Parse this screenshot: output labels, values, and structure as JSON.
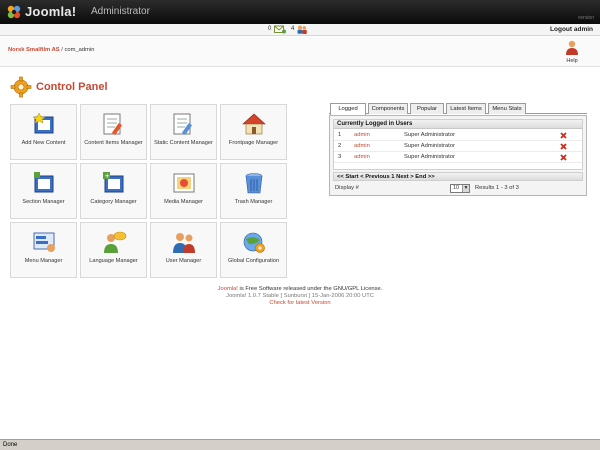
{
  "header": {
    "brand": "Joomla!",
    "subtitle": "Administrator",
    "version_tag": "version"
  },
  "statusbar": {
    "messages_count": "0",
    "messages_icon": "mail-icon",
    "users_count": "4",
    "users_icon": "users-icon",
    "logout_label": "Logout admin"
  },
  "pathway": {
    "site": "Norsk Smalfilm AS",
    "separator": " / ",
    "component": "com_admin",
    "help_label": "Help"
  },
  "page_title": "Control Panel",
  "icons": [
    {
      "label": "Add New Content",
      "icon": "add-content-icon"
    },
    {
      "label": "Content Items Manager",
      "icon": "content-items-icon"
    },
    {
      "label": "Static Content Manager",
      "icon": "static-content-icon"
    },
    {
      "label": "Frontpage Manager",
      "icon": "frontpage-icon"
    },
    {
      "label": "Section Manager",
      "icon": "section-icon"
    },
    {
      "label": "Category Manager",
      "icon": "category-icon"
    },
    {
      "label": "Media Manager",
      "icon": "media-icon"
    },
    {
      "label": "Trash Manager",
      "icon": "trash-icon"
    },
    {
      "label": "Menu Manager",
      "icon": "menu-icon"
    },
    {
      "label": "Language Manager",
      "icon": "language-icon"
    },
    {
      "label": "User Manager",
      "icon": "user-icon"
    },
    {
      "label": "Global Configuration",
      "icon": "global-config-icon"
    }
  ],
  "tabs": [
    "Logged",
    "Components",
    "Popular",
    "Latest Items",
    "Menu Stats"
  ],
  "logged_panel": {
    "header": "Currently Logged in Users",
    "rows": [
      {
        "num": "1",
        "name": "admin",
        "role": "Super Administrator"
      },
      {
        "num": "2",
        "name": "admin",
        "role": "Super Administrator"
      },
      {
        "num": "3",
        "name": "admin",
        "role": "Super Administrator"
      }
    ],
    "pager": "<< Start < Previous 1 Next > End >>",
    "display_label": "Display #",
    "display_value": "10",
    "results": "Results 1 - 3 of 3"
  },
  "footer": {
    "joomla_link": "Joomla!",
    "line1_rest": " is Free Software released under the GNU/GPL License.",
    "line2": "Joomla! 1.0.7 Stable [ Sunburst ] 15-Jan-2006 20:00 UTC",
    "line3": "Check for latest Version"
  },
  "browser_status": "Done",
  "colors": {
    "accent": "#c64934",
    "header_bg": "#1a1a1a",
    "tile_bg": "#f8f8f8"
  }
}
